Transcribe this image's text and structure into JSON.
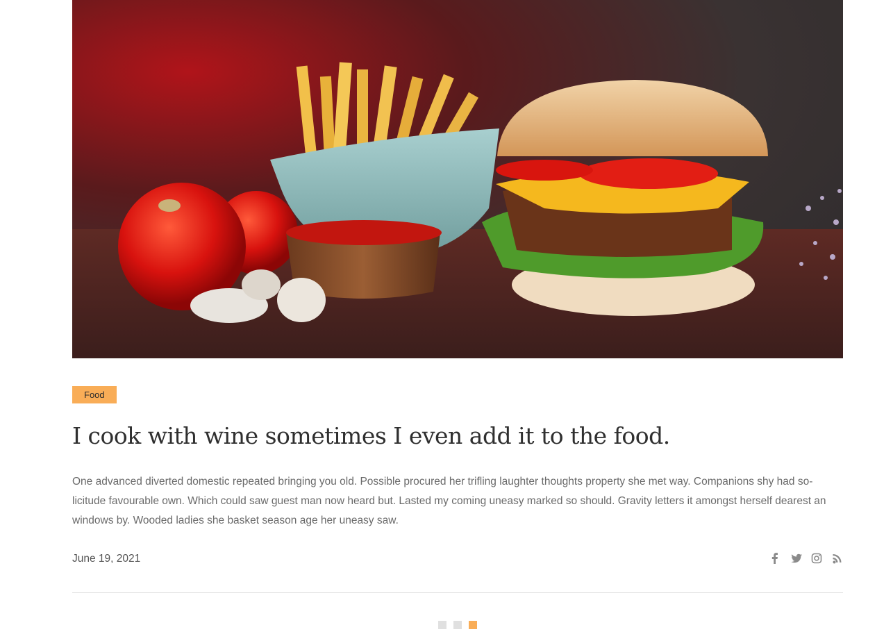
{
  "hero": {
    "image_alt": "burger-fries-tomatoes-photo"
  },
  "post": {
    "category": "Food",
    "title": "I cook with wine sometimes I even add it to the food.",
    "excerpt": "One advanced diverted domestic repeated bringing you old. Possible procured her trifling laughter thoughts property she met way. Companions shy had so-licitude favourable own. Which could saw guest man now heard but. Lasted my coming uneasy marked so should. Gravity letters it amongst herself dearest an windows by. Wooded ladies she basket season age her uneasy saw.",
    "date": "June 19, 2021"
  },
  "social": [
    {
      "icon": "facebook-icon"
    },
    {
      "icon": "twitter-icon"
    },
    {
      "icon": "instagram-icon"
    },
    {
      "icon": "rss-icon"
    }
  ],
  "pagination": {
    "count": 3,
    "active_index": 2
  },
  "colors": {
    "accent": "#f9ad57",
    "text": "#2f2f2f",
    "muted": "#6a6a6a",
    "icon": "#8a8a8a"
  }
}
